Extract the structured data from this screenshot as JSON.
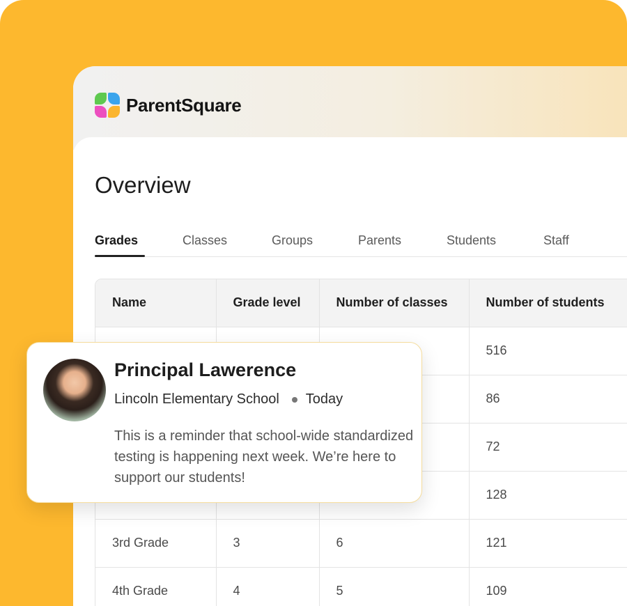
{
  "brand": {
    "name": "ParentSquare"
  },
  "page": {
    "title": "Overview"
  },
  "tabs": [
    {
      "label": "Grades",
      "active": true
    },
    {
      "label": "Classes",
      "active": false
    },
    {
      "label": "Groups",
      "active": false
    },
    {
      "label": "Parents",
      "active": false
    },
    {
      "label": "Students",
      "active": false
    },
    {
      "label": "Staff",
      "active": false
    }
  ],
  "table": {
    "headers": [
      "Name",
      "Grade level",
      "Number of classes",
      "Number of students"
    ],
    "rows": [
      [
        "",
        "",
        "",
        "516"
      ],
      [
        "",
        "",
        "",
        "86"
      ],
      [
        "",
        "",
        "",
        "72"
      ],
      [
        "",
        "",
        "",
        "128"
      ],
      [
        "3rd Grade",
        "3",
        "6",
        "121"
      ],
      [
        "4th Grade",
        "4",
        "5",
        "109"
      ]
    ]
  },
  "notification": {
    "sender": "Principal Lawerence",
    "school": "Lincoln Elementary School",
    "time": "Today",
    "message": "This is a reminder that school-wide standardized testing is happening next week. We’re here to support our students!"
  },
  "colors": {
    "background": "#fdb82e",
    "card_border": "#f5dc9c"
  }
}
